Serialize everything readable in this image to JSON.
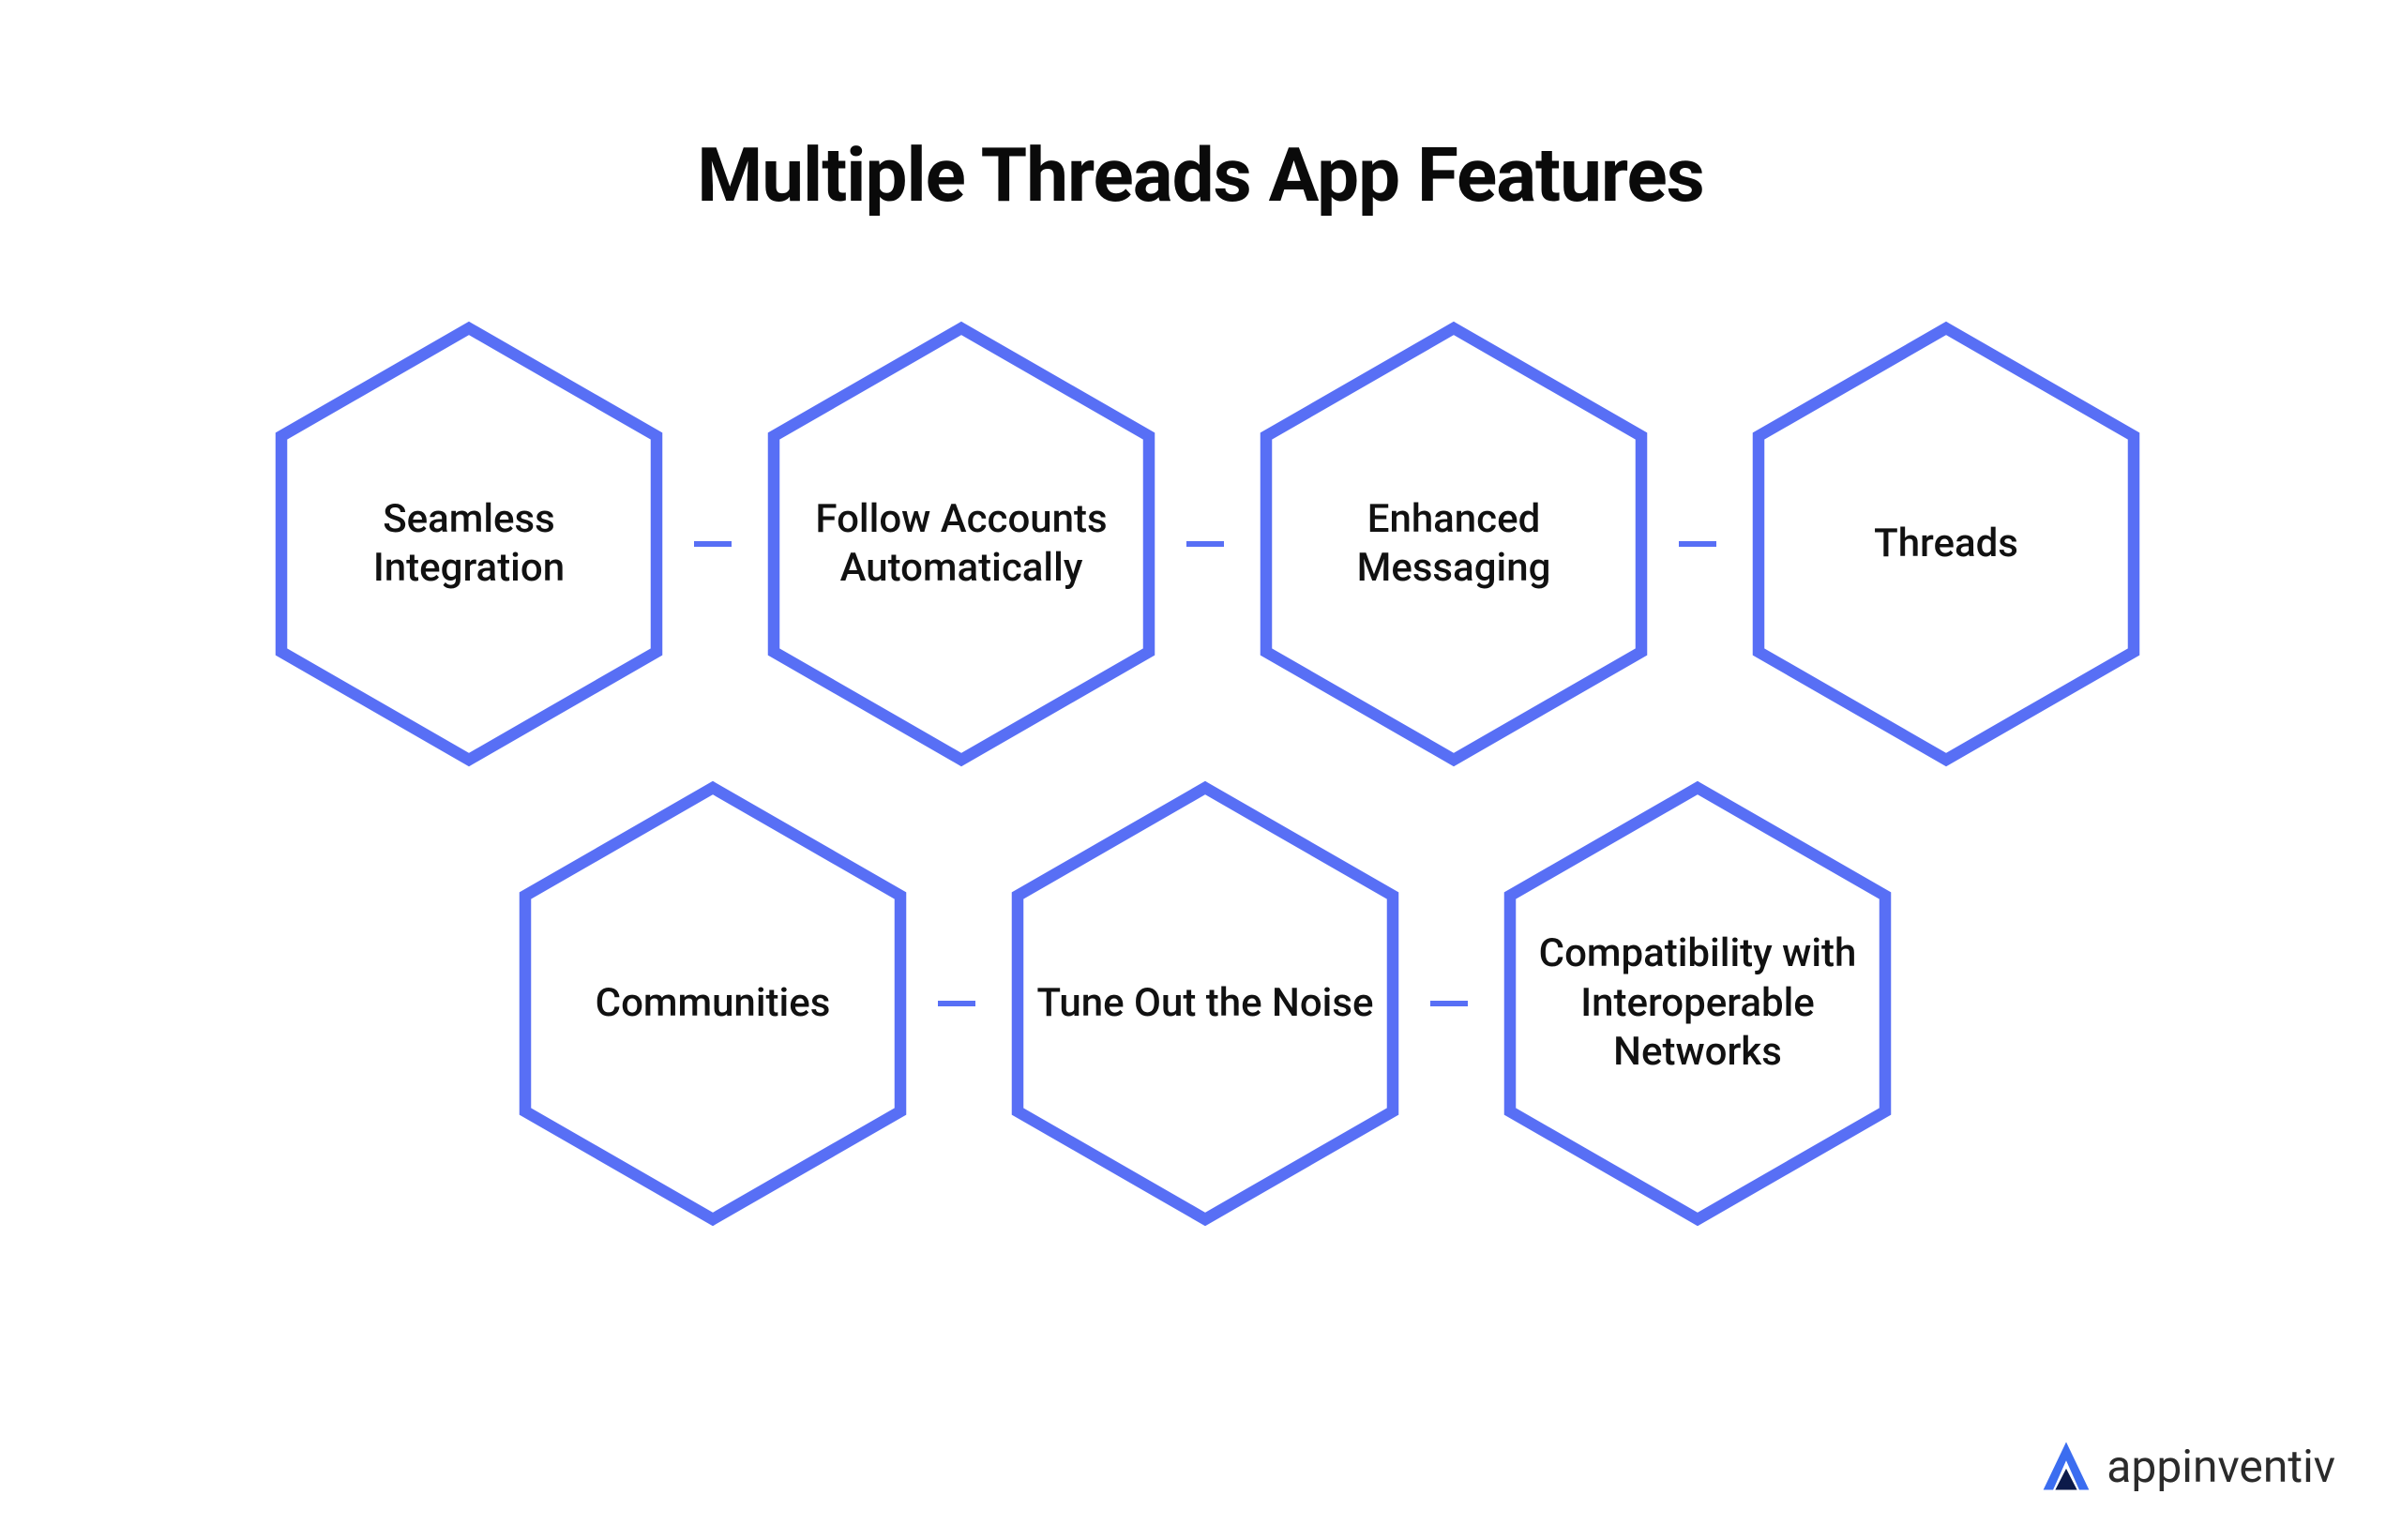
{
  "title": "Multiple Threads App Features",
  "colors": {
    "hex_stroke": "#586ff5",
    "hex_fill": "#ffffff",
    "text": "#111111",
    "brand_accent": "#3b6df0",
    "brand_text": "#2b2b2b"
  },
  "hexagons": {
    "row1": [
      {
        "label": "Seamless Integration"
      },
      {
        "label": "Follow Accounts Automatically"
      },
      {
        "label": "Enhanced Messaging"
      },
      {
        "label": "Threads"
      }
    ],
    "row2": [
      {
        "label": "Communities"
      },
      {
        "label": "Tune Out the Noise"
      },
      {
        "label": "Compatibility with Interoperable Networks"
      }
    ]
  },
  "brand": {
    "name": "appinventiv"
  }
}
